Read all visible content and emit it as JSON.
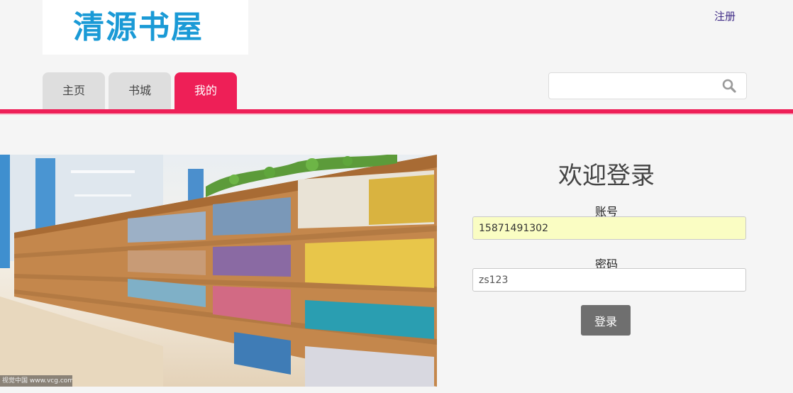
{
  "logo": {
    "text": "清源书屋"
  },
  "header": {
    "register_label": "注册"
  },
  "nav": {
    "tabs": [
      {
        "label": "主页",
        "active": false
      },
      {
        "label": "书城",
        "active": false
      },
      {
        "label": "我的",
        "active": true
      }
    ]
  },
  "search": {
    "value": "",
    "placeholder": "",
    "icon": "search-icon"
  },
  "banner": {
    "watermark": "视觉中国 www.vcg.com"
  },
  "login": {
    "title": "欢迎登录",
    "account_label": "账号",
    "account_value": "15871491302",
    "password_label": "密码",
    "password_value": "zs123",
    "submit_label": "登录"
  },
  "colors": {
    "accent": "#ee1f57",
    "logo": "#1a9ad6",
    "tab_inactive": "#dedede",
    "button": "#6f6f6f",
    "autofill": "#fafdc3"
  }
}
